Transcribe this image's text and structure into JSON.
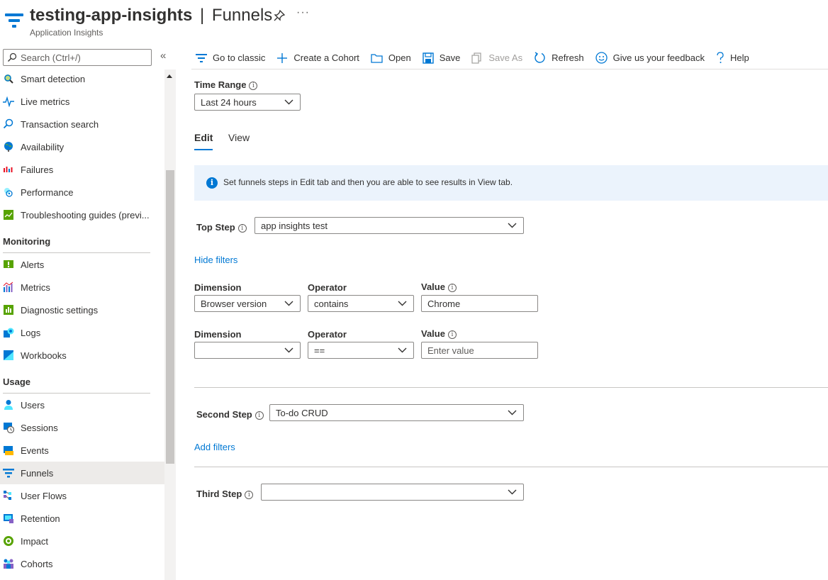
{
  "header": {
    "app_name": "testing-app-insights",
    "separator": "|",
    "page_name": "Funnels",
    "subtitle": "Application Insights",
    "more": "···"
  },
  "sidebar": {
    "search_placeholder": "Search (Ctrl+/)",
    "collapse_glyph": "«",
    "items_top": [
      {
        "label": "Smart detection",
        "icon": "smart-detection-icon"
      },
      {
        "label": "Live metrics",
        "icon": "live-metrics-icon"
      },
      {
        "label": "Transaction search",
        "icon": "transaction-search-icon"
      },
      {
        "label": "Availability",
        "icon": "availability-icon"
      },
      {
        "label": "Failures",
        "icon": "failures-icon"
      },
      {
        "label": "Performance",
        "icon": "performance-icon"
      },
      {
        "label": "Troubleshooting guides (previ...",
        "icon": "troubleshooting-icon"
      }
    ],
    "section_monitoring": "Monitoring",
    "items_monitoring": [
      {
        "label": "Alerts",
        "icon": "alerts-icon"
      },
      {
        "label": "Metrics",
        "icon": "metrics-icon"
      },
      {
        "label": "Diagnostic settings",
        "icon": "diagnostic-settings-icon"
      },
      {
        "label": "Logs",
        "icon": "logs-icon"
      },
      {
        "label": "Workbooks",
        "icon": "workbooks-icon"
      }
    ],
    "section_usage": "Usage",
    "items_usage": [
      {
        "label": "Users",
        "icon": "users-icon"
      },
      {
        "label": "Sessions",
        "icon": "sessions-icon"
      },
      {
        "label": "Events",
        "icon": "events-icon"
      },
      {
        "label": "Funnels",
        "icon": "funnels-icon",
        "selected": true
      },
      {
        "label": "User Flows",
        "icon": "user-flows-icon"
      },
      {
        "label": "Retention",
        "icon": "retention-icon"
      },
      {
        "label": "Impact",
        "icon": "impact-icon"
      },
      {
        "label": "Cohorts",
        "icon": "cohorts-icon"
      }
    ]
  },
  "toolbar": {
    "go_to_classic": "Go to classic",
    "create_cohort": "Create a Cohort",
    "open": "Open",
    "save": "Save",
    "save_as": "Save As",
    "refresh": "Refresh",
    "feedback": "Give us your feedback",
    "help": "Help"
  },
  "main": {
    "time_range_label": "Time Range",
    "time_range_value": "Last 24 hours",
    "tabs": {
      "edit": "Edit",
      "view": "View"
    },
    "info_banner": "Set funnels steps in Edit tab and then you are able to see results in View tab.",
    "top_step_label": "Top Step",
    "top_step_value": "app insights test",
    "hide_filters": "Hide filters",
    "filters": [
      {
        "dimension_label": "Dimension",
        "operator_label": "Operator",
        "value_label": "Value",
        "dimension": "Browser version",
        "operator": "contains",
        "value": "Chrome",
        "value_placeholder": "Enter value"
      },
      {
        "dimension_label": "Dimension",
        "operator_label": "Operator",
        "value_label": "Value",
        "dimension": "",
        "operator": "==",
        "value": "",
        "value_placeholder": "Enter value"
      }
    ],
    "second_step_label": "Second Step",
    "second_step_value": "To-do CRUD",
    "add_filters": "Add filters",
    "third_step_label": "Third Step",
    "third_step_value": ""
  },
  "colors": {
    "accent": "#0078d4",
    "banner_bg": "#ebf3fc",
    "selected_bg": "#edebe9"
  }
}
